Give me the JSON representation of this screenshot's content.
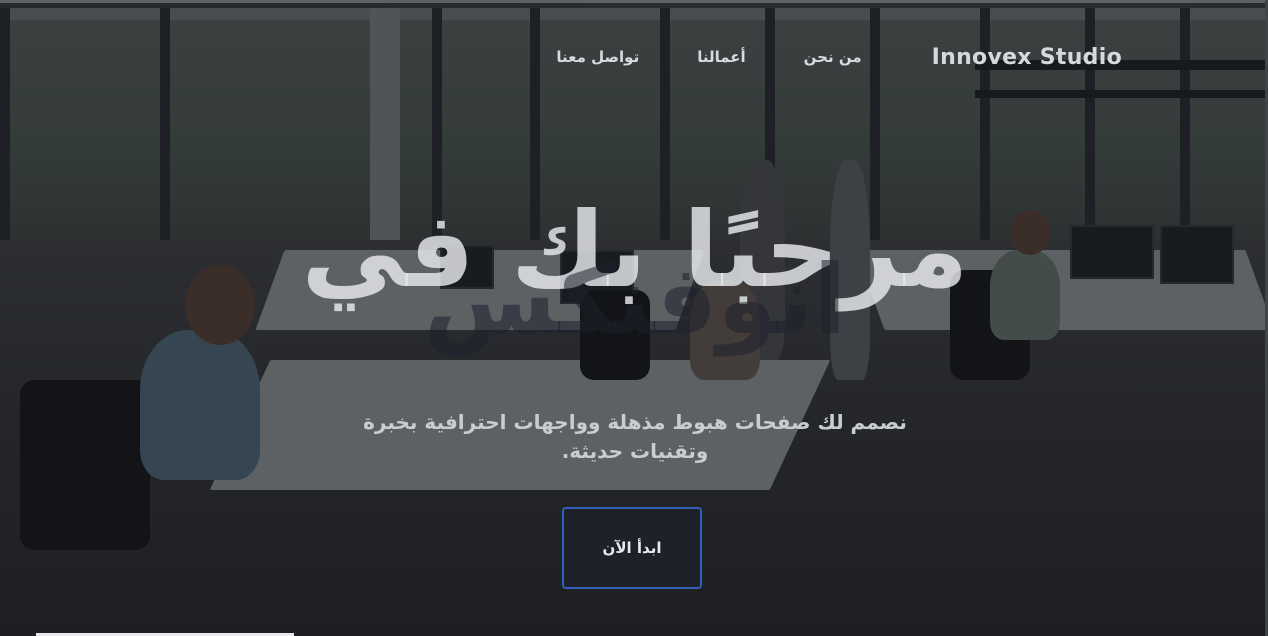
{
  "nav": {
    "brand": "Innovex Studio",
    "links": [
      {
        "label": "من نحن"
      },
      {
        "label": "أعمالنا"
      },
      {
        "label": "تواصل معنا"
      }
    ]
  },
  "hero": {
    "headline_line1": "مرحبًا بك في",
    "headline_line2": "انوفنكس",
    "subtitle": "نصمم لك صفحات هبوط مذهلة وواجهات احترافية بخبرة وتقنيات حديثة.",
    "cta_label": "ابدأ الآن"
  },
  "colors": {
    "accent_border": "#2f5fb7",
    "overlay": "#14161a"
  },
  "background": "office-photo"
}
